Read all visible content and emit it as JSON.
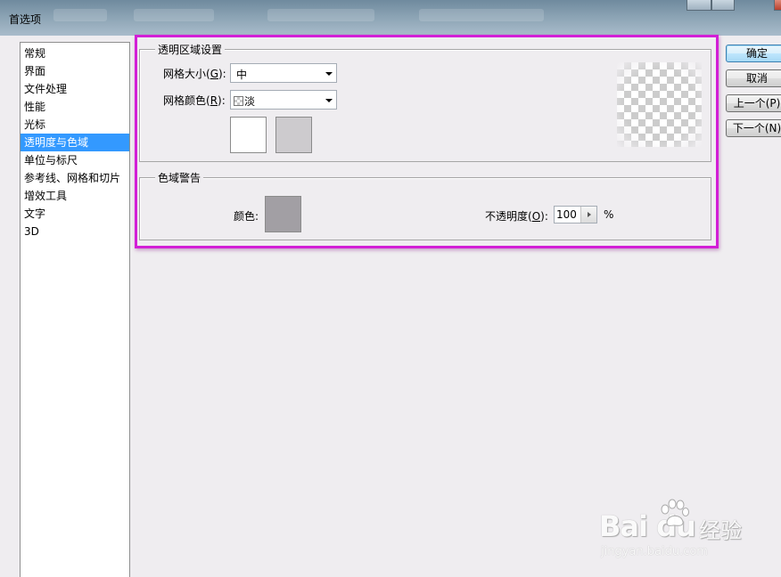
{
  "window": {
    "title": "首选项"
  },
  "sidebar": {
    "items": [
      {
        "label": "常规"
      },
      {
        "label": "界面"
      },
      {
        "label": "文件处理"
      },
      {
        "label": "性能"
      },
      {
        "label": "光标"
      },
      {
        "label": "透明度与色域",
        "selected": true
      },
      {
        "label": "单位与标尺"
      },
      {
        "label": "参考线、网格和切片"
      },
      {
        "label": "增效工具"
      },
      {
        "label": "文字"
      },
      {
        "label": "3D"
      }
    ]
  },
  "transparency": {
    "group_label": "透明区域设置",
    "grid_size_label": "网格大小(",
    "grid_size_key": "G",
    "grid_size_tail": "):",
    "grid_size_value": "中",
    "grid_color_label": "网格颜色(",
    "grid_color_key": "R",
    "grid_color_tail": "):",
    "grid_color_value": "淡",
    "swatch_light": "#ffffff",
    "swatch_dark": "#cdcbce"
  },
  "gamut": {
    "group_label": "色域警告",
    "color_label": "颜色:",
    "color_value": "#a29fa4",
    "opacity_label": "不透明度(",
    "opacity_key": "O",
    "opacity_tail": "):",
    "opacity_value": "100",
    "opacity_unit": "%"
  },
  "buttons": {
    "ok": "确定",
    "cancel": "取消",
    "prev": "上一个(P)",
    "next": "下一个(N)"
  },
  "watermark": {
    "brand": "Bai du",
    "cn": "经验",
    "url": "jingyan.baidu.com"
  },
  "colors": {
    "highlight_outline": "#d21fd6",
    "selection": "#3399ff",
    "dialog_bg": "#efedf0"
  }
}
